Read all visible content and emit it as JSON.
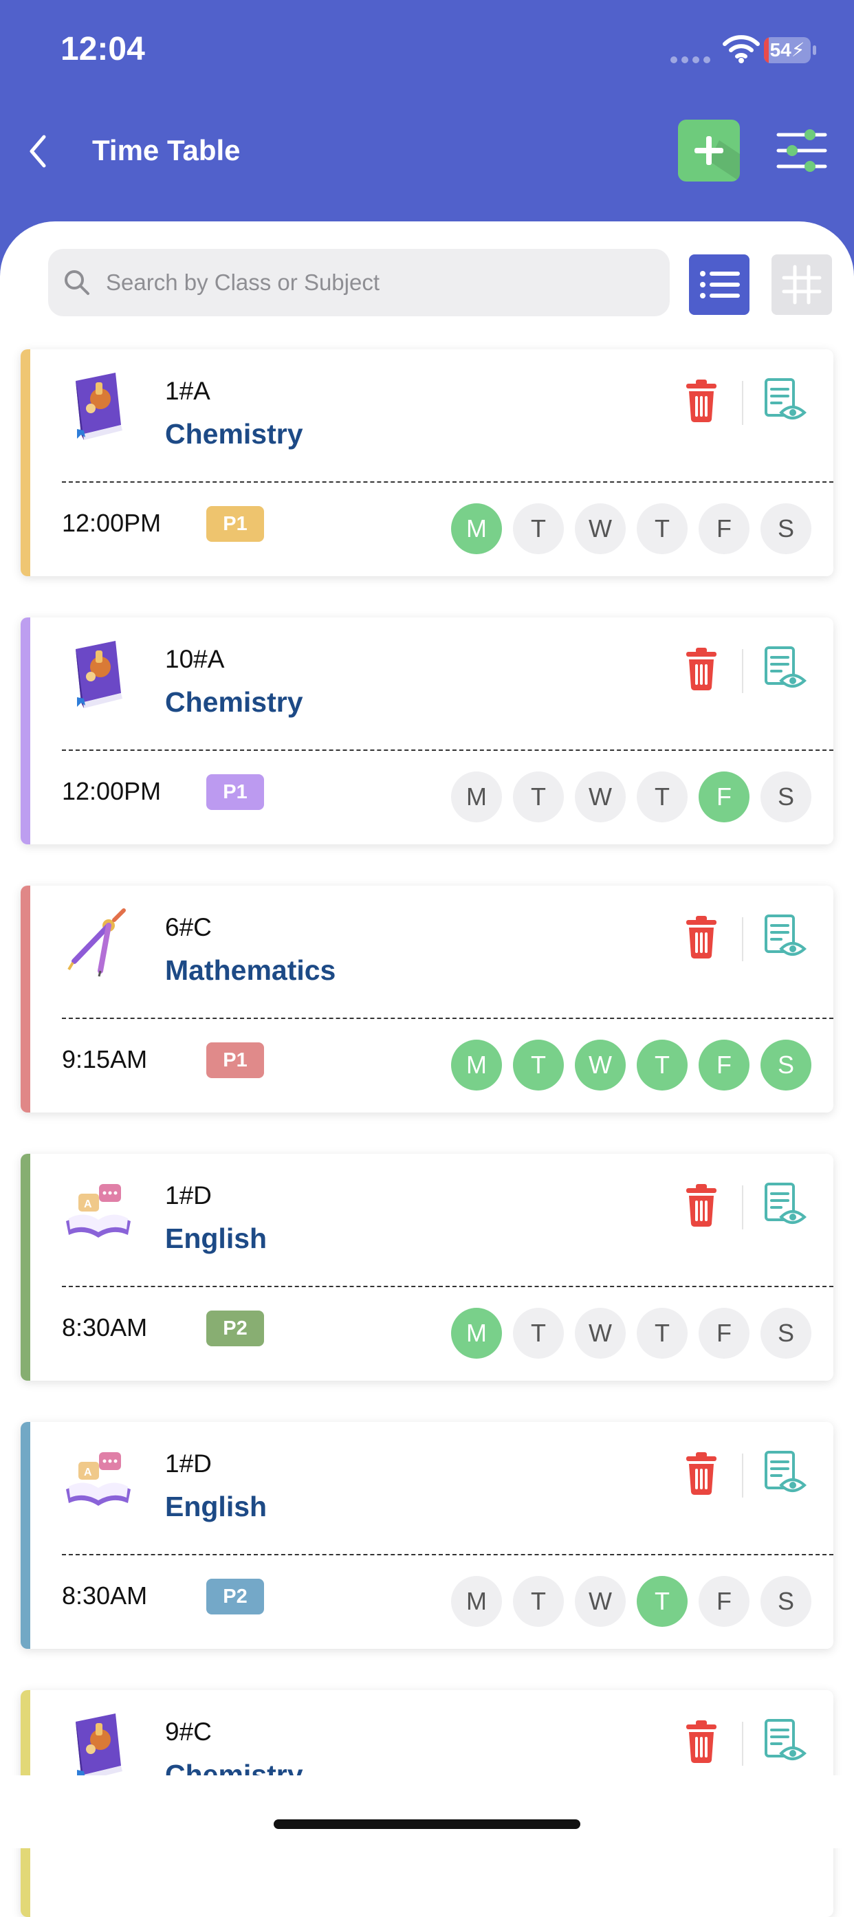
{
  "status_bar": {
    "time": "12:04",
    "battery": "54"
  },
  "header": {
    "title": "Time Table"
  },
  "search": {
    "placeholder": "Search by Class or Subject"
  },
  "colors": {
    "header_bg": "#5161CB",
    "active_day": "#79D08A",
    "subject_text": "#1D4A86",
    "delete": "#E9463F",
    "view": "#4FB7B1"
  },
  "cards": [
    {
      "class": "1#A",
      "subject": "Chemistry",
      "icon": "chemistry-book-icon",
      "time": "12:00PM",
      "period": "P1",
      "color": "#EEC46E",
      "stripe": "#EFC673",
      "days": [
        {
          "label": "M",
          "active": true
        },
        {
          "label": "T",
          "active": false
        },
        {
          "label": "W",
          "active": false
        },
        {
          "label": "T",
          "active": false
        },
        {
          "label": "F",
          "active": false
        },
        {
          "label": "S",
          "active": false
        }
      ]
    },
    {
      "class": "10#A",
      "subject": "Chemistry",
      "icon": "chemistry-book-icon",
      "time": "12:00PM",
      "period": "P1",
      "color": "#BC9AF0",
      "stripe": "#BD9EF0",
      "days": [
        {
          "label": "M",
          "active": false
        },
        {
          "label": "T",
          "active": false
        },
        {
          "label": "W",
          "active": false
        },
        {
          "label": "T",
          "active": false
        },
        {
          "label": "F",
          "active": true
        },
        {
          "label": "S",
          "active": false
        }
      ]
    },
    {
      "class": "6#C",
      "subject": "Mathematics",
      "icon": "compass-icon",
      "time": "9:15AM",
      "period": "P1",
      "color": "#E08A8A",
      "stripe": "#E08787",
      "days": [
        {
          "label": "M",
          "active": true
        },
        {
          "label": "T",
          "active": true
        },
        {
          "label": "W",
          "active": true
        },
        {
          "label": "T",
          "active": true
        },
        {
          "label": "F",
          "active": true
        },
        {
          "label": "S",
          "active": true
        }
      ]
    },
    {
      "class": "1#D",
      "subject": "English",
      "icon": "english-book-icon",
      "time": "8:30AM",
      "period": "P2",
      "color": "#88AE72",
      "stripe": "#86AE71",
      "days": [
        {
          "label": "M",
          "active": true
        },
        {
          "label": "T",
          "active": false
        },
        {
          "label": "W",
          "active": false
        },
        {
          "label": "T",
          "active": false
        },
        {
          "label": "F",
          "active": false
        },
        {
          "label": "S",
          "active": false
        }
      ]
    },
    {
      "class": "1#D",
      "subject": "English",
      "icon": "english-book-icon",
      "time": "8:30AM",
      "period": "P2",
      "color": "#74A8C8",
      "stripe": "#72A8C5",
      "days": [
        {
          "label": "M",
          "active": false
        },
        {
          "label": "T",
          "active": false
        },
        {
          "label": "W",
          "active": false
        },
        {
          "label": "T",
          "active": true
        },
        {
          "label": "F",
          "active": false
        },
        {
          "label": "S",
          "active": false
        }
      ]
    },
    {
      "class": "9#C",
      "subject": "Chemistry",
      "icon": "chemistry-book-icon",
      "time": "",
      "period": "",
      "color": "#E2D877",
      "stripe": "#E2D877",
      "days": []
    }
  ]
}
